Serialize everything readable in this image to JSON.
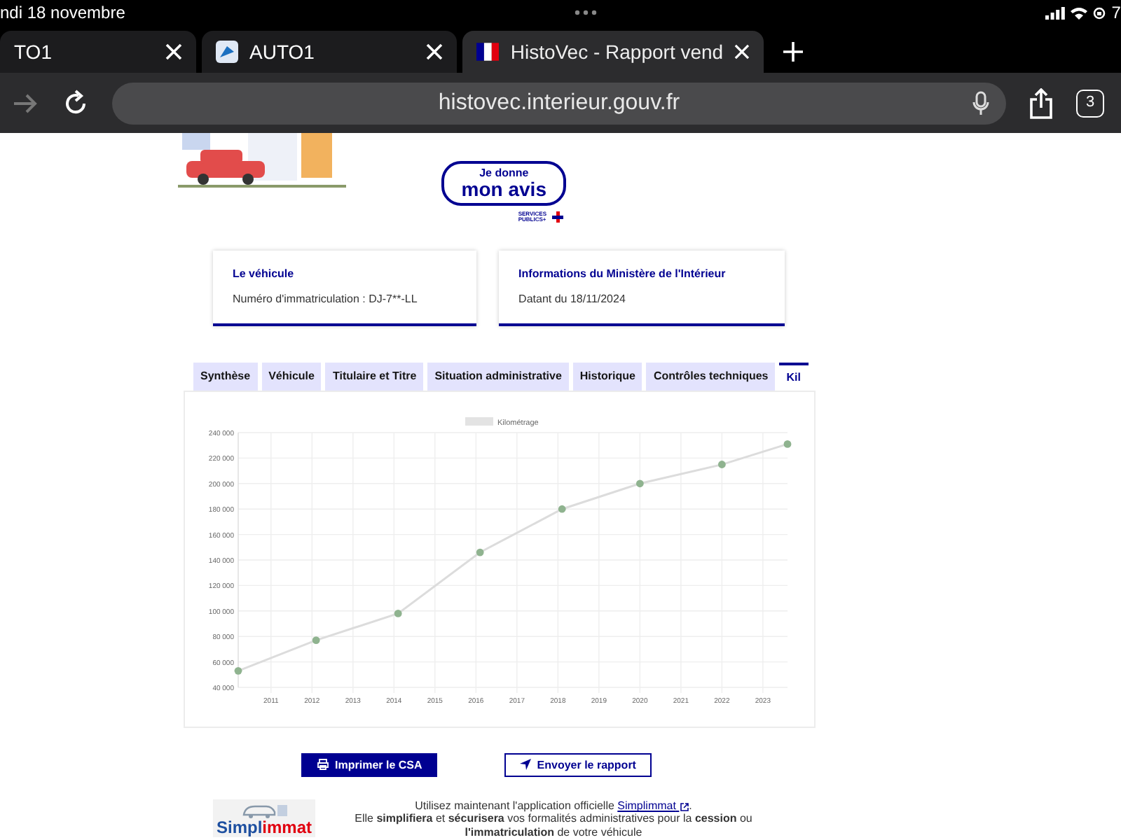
{
  "status_bar": {
    "date": "ndi 18 novembre",
    "battery": "7"
  },
  "browser_tabs": [
    {
      "title": "TO1",
      "selected": false,
      "kind": "plain"
    },
    {
      "title": "AUTO1",
      "selected": false,
      "kind": "app"
    },
    {
      "title": "HistoVec - Rapport vend",
      "selected": true,
      "kind": "flag"
    }
  ],
  "address_bar": {
    "url": "histovec.interieur.gouv.fr",
    "tab_count": "3"
  },
  "feedback_badge": {
    "line_1": "Je donne",
    "line_2": "mon avis",
    "caption_1": "SERVICES",
    "caption_2": "PUBLICS+"
  },
  "info_cards": [
    {
      "title": "Le véhicule",
      "text": "Numéro d'immatriculation : DJ-7**-LL"
    },
    {
      "title": "Informations du Ministère de l'Intérieur",
      "text": "Datant du 18/11/2024"
    }
  ],
  "report_tabs": [
    {
      "label": "Synthèse",
      "selected": false
    },
    {
      "label": "Véhicule",
      "selected": false
    },
    {
      "label": "Titulaire et Titre",
      "selected": false
    },
    {
      "label": "Situation administrative",
      "selected": false
    },
    {
      "label": "Historique",
      "selected": false
    },
    {
      "label": "Contrôles techniques",
      "selected": false
    },
    {
      "label": "Kil",
      "selected": true
    }
  ],
  "mileage_panel": {
    "chart_data": {
      "type": "line",
      "grid": true,
      "x": [
        2010.2,
        2012.1,
        2014.1,
        2016.1,
        2018.1,
        2020.0,
        2022.0,
        2023.6
      ],
      "series": [
        {
          "name": "Kilométrage",
          "color": "#8fb38f",
          "marker": "circle",
          "values": [
            53000,
            77000,
            98000,
            146000,
            180000,
            200000,
            215000,
            231000
          ]
        }
      ],
      "xlim": [
        2010.2,
        2023.6
      ],
      "ylim": [
        40000,
        240000
      ],
      "xticks": [
        2011,
        2012,
        2013,
        2014,
        2015,
        2016,
        2017,
        2018,
        2019,
        2020,
        2021,
        2022,
        2023
      ],
      "yticks": [
        {
          "value": 40000,
          "label": "40 000"
        },
        {
          "value": 60000,
          "label": "60 000"
        },
        {
          "value": 80000,
          "label": "80 000"
        },
        {
          "value": 100000,
          "label": "100 000"
        },
        {
          "value": 120000,
          "label": "120 000"
        },
        {
          "value": 140000,
          "label": "140 000"
        },
        {
          "value": 160000,
          "label": "160 000"
        },
        {
          "value": 180000,
          "label": "180 000"
        },
        {
          "value": 200000,
          "label": "200 000"
        },
        {
          "value": 220000,
          "label": "220 000"
        },
        {
          "value": 240000,
          "label": "240 000"
        }
      ]
    }
  },
  "actions": [
    {
      "label": "Imprimer le CSA",
      "kind": "primary"
    },
    {
      "label": "Envoyer le rapport",
      "kind": "secondary"
    }
  ],
  "promo": {
    "logo_part_1": "Simpl",
    "logo_part_2": "immat",
    "text_before": "Utilisez maintenant l'application officielle",
    "link": "Simplimmat",
    "text_after": ".",
    "line_2": "Elle **simplifiera** et **sécurisera** vos formalités administratives pour la **cession** ou",
    "line_3": "**l'immatriculation** de votre véhicule"
  }
}
